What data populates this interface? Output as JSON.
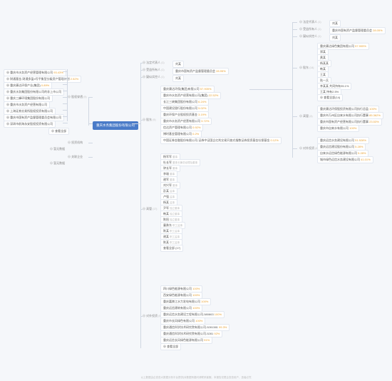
{
  "root": "重庆水务集团股份有限公司",
  "left": {
    "eqhold": {
      "label": "股权穿透",
      "items": [
        {
          "n": "重庆市水务资产经营管理有限公司",
          "p": "93.43%"
        },
        {
          "n": "财通基金-财通多盈4号平衡型分级资产管理计划",
          "p": "2.52%"
        },
        {
          "n": "重庆康达环保产业(集团)",
          "p": "0.89%"
        },
        {
          "n": "重庆水务集团股份有限公司的非上市公司"
        },
        {
          "n": "重庆三峰环境集团股份有限公司"
        },
        {
          "n": "重庆市水务资产经营有限公司"
        },
        {
          "n": "上海证券交易所股权投资有限公司"
        },
        {
          "n": "重庆市国有资产监督管理委员会有限公司"
        },
        {
          "n": "深圳市前海永安股权投资有限公司"
        }
      ],
      "more": "查看全部"
    },
    "invest": {
      "label": "投资机构",
      "none": "暂无数据"
    },
    "related": {
      "label": "关联企业",
      "none": "暂无数据"
    }
  },
  "mid": {
    "legal": {
      "label": "法定代表人",
      "v": "刘某"
    },
    "benefit": {
      "label": "受益所有人",
      "v": "重庆市国有资产监督管理委员会",
      "p": "28.95%"
    },
    "control": {
      "label": "疑似实控人",
      "v": "刘某"
    },
    "share": {
      "label": "股东",
      "items": [
        {
          "n": "重庆康达环保(集团)有限公司",
          "p": "57.905%"
        },
        {
          "n": "重庆市水务资产经营有限公司(集团)",
          "p": "22.52%"
        },
        {
          "n": "长江三峡集团股份有限公司",
          "p": "6.24%"
        },
        {
          "n": "中国建设银行股份有限公司",
          "p": "5.02%"
        },
        {
          "n": "重庆环保产业股权投资基金",
          "p": "3.19%"
        },
        {
          "n": "重庆市水务资产经营有限公司",
          "p": "3.72%"
        },
        {
          "n": "信达资产管理有限公司",
          "p": "0.92%"
        },
        {
          "n": "博时基金管理有限公司",
          "p": "0.2%"
        },
        {
          "n": "中国证券金融股份有限公司-证券中证国企红利交易开放式指数证券投资基金社保基金",
          "p": "0.12%"
        }
      ]
    },
    "execs": {
      "label": "高管",
      "items": [
        {
          "n": "杨军军",
          "r": "董事"
        },
        {
          "n": "杜长军",
          "r": "董事长兼总经理及董事"
        },
        {
          "n": "钟长军",
          "r": "董事"
        },
        {
          "n": "李雄",
          "r": "董事"
        },
        {
          "n": "谢军",
          "r": "董事"
        },
        {
          "n": "刘兴军",
          "r": "董事"
        },
        {
          "n": "彭某",
          "r": "监事"
        },
        {
          "n": "卢强",
          "r": "监事"
        },
        {
          "n": "杨某",
          "r": "监事"
        },
        {
          "n": "尹军",
          "r": "独立董事"
        },
        {
          "n": "韩某",
          "r": "独立董事"
        },
        {
          "n": "陈阳",
          "r": "独立董事"
        },
        {
          "n": "童勇东",
          "r": "职工监事"
        },
        {
          "n": "陈某",
          "r": "职工监事"
        },
        {
          "n": "谢某",
          "r": "职工监事"
        },
        {
          "n": "陈某",
          "r": "职工监事"
        }
      ]
    },
    "outinv": {
      "label": "对外投资",
      "items": [
        {
          "n": "四川绿色能源有限公司",
          "p": "100%"
        },
        {
          "n": "西安绿色能源有限公司",
          "p": "100%"
        },
        {
          "n": "重庆嘉陵江水力发电有限公司",
          "p": "100%"
        },
        {
          "n": "重庆远信建筑有限公司",
          "p": "100%"
        },
        {
          "n": "重庆远信水务建设工程有限公司-580863",
          "p": "100%"
        },
        {
          "n": "重庆市长风绿色有限公司",
          "p": "100%"
        },
        {
          "n": "重庆通信科学技术研究院有限公司-5281381",
          "p": "99.3%"
        },
        {
          "n": "重庆通信科学技术研究院有限公司-5281",
          "p": "92%"
        },
        {
          "n": "重庆远信长风绿色能源有限公司",
          "p": "91%"
        }
      ],
      "more": "查看全部"
    }
  },
  "right": {
    "legal": {
      "label": "法定代表人",
      "v": "刘某"
    },
    "benefit": {
      "label": "受益所有人",
      "v": "重庆市国有资产监督管理委员会",
      "p": "28.05%"
    },
    "control": {
      "label": "疑似实控人",
      "v": "刘某"
    },
    "share": {
      "label": "股东",
      "items": [
        {
          "n": "重庆康达绿色集团有限公司",
          "p": "57.905%"
        },
        {
          "n": "郑某",
          "r": ""
        },
        {
          "n": "黄某",
          "r": ""
        },
        {
          "n": "杨某某",
          "r": ""
        },
        {
          "n": "韩某",
          "r": ""
        },
        {
          "n": "王某",
          "r": ""
        },
        {
          "n": "陆一兵",
          "r": ""
        },
        {
          "n": "李某某 共同持有35.1%",
          "r": ""
        },
        {
          "n": "王某 持有2.5%",
          "r": ""
        }
      ],
      "more": "查看全部(14)"
    },
    "execs": {
      "label": "高管",
      "items": [
        {
          "n": "重庆康达环保股投资有限公司执行总监",
          "p": "100%"
        },
        {
          "n": "重庆市万州区自来水有限公司执行董事",
          "p": "85.362%"
        },
        {
          "n": "重庆市国有资产经营有限公司执行董事",
          "p": "23.53%"
        },
        {
          "n": "重庆市自来水有限公司",
          "p": "100%"
        }
      ]
    },
    "outinv": {
      "label": "对外投资",
      "items": [
        {
          "n": "重庆远信水务建设有限公司",
          "p": "51.928%"
        },
        {
          "n": "重庆远信建设股份有限公司",
          "p": "5.28%"
        },
        {
          "n": "自来水远信绿色能源有限公司",
          "p": "5.28%"
        },
        {
          "n": "城市绿色远信水务建设有限公司",
          "p": "41.01%"
        }
      ]
    }
  },
  "footer": "以上数据由企查查大数据分析平台提供|对数据有疑问请联系客服。本报告仅限企查查用户，违者必究"
}
